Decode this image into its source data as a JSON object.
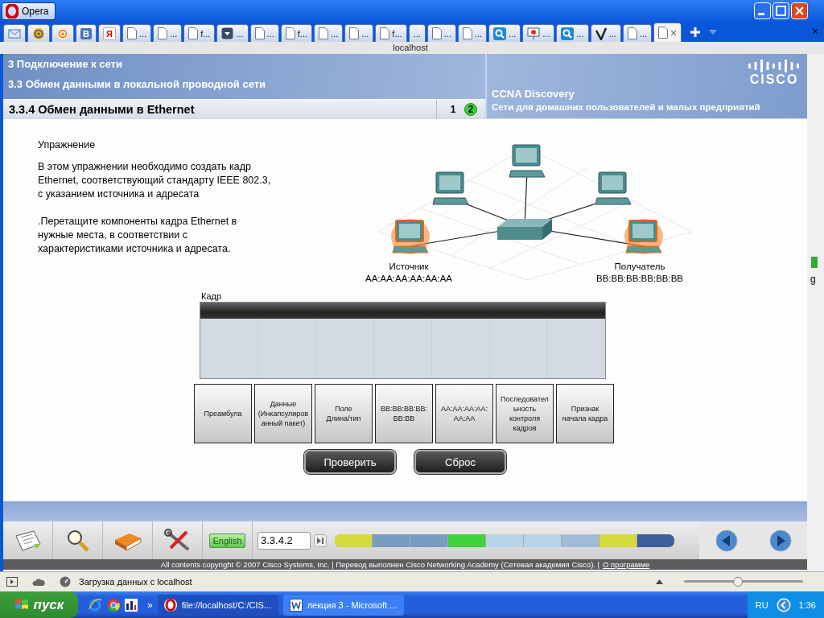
{
  "browser": {
    "menu_button": "Opera",
    "address": "localhost",
    "tabs": [
      {
        "kind": "mail",
        "selected": false
      },
      {
        "kind": "at",
        "selected": false
      },
      {
        "kind": "at-orange",
        "selected": false
      },
      {
        "kind": "letter",
        "glyph": "В",
        "selected": false
      },
      {
        "kind": "letter-red",
        "glyph": "Я",
        "selected": false
      },
      {
        "kind": "page",
        "label": "...",
        "selected": false
      },
      {
        "kind": "page",
        "label": "...",
        "selected": false
      },
      {
        "kind": "page",
        "label": "f...",
        "selected": false
      },
      {
        "kind": "download",
        "label": "...",
        "selected": false
      },
      {
        "kind": "page",
        "label": "...",
        "selected": false
      },
      {
        "kind": "page",
        "label": "f...",
        "selected": false
      },
      {
        "kind": "page",
        "label": "...",
        "selected": false
      },
      {
        "kind": "page",
        "label": "...",
        "selected": false
      },
      {
        "kind": "page",
        "label": "f...",
        "selected": false
      },
      {
        "kind": "blank",
        "label": "...",
        "selected": false
      },
      {
        "kind": "page",
        "label": "...",
        "selected": false
      },
      {
        "kind": "page",
        "label": "...",
        "selected": false
      },
      {
        "kind": "search",
        "label": "...",
        "selected": false
      },
      {
        "kind": "slide",
        "label": "...",
        "selected": false
      },
      {
        "kind": "search",
        "label": "...",
        "selected": false
      },
      {
        "kind": "check",
        "label": "...",
        "selected": false
      },
      {
        "kind": "page",
        "label": "...",
        "selected": false
      },
      {
        "kind": "page",
        "close": "×",
        "selected": true
      }
    ],
    "side_texts": [
      "×",
      "g"
    ]
  },
  "course": {
    "chapter": "3 Подключение к сети",
    "section": "3.3 Обмен данными в локальной проводной сети",
    "topic": "3.3.4 Обмен данными в Ethernet",
    "pages": [
      {
        "label": "1",
        "selected": false
      },
      {
        "label": "2",
        "selected": true
      }
    ],
    "brand": "CISCO",
    "product": "CCNA Discovery",
    "subtitle": "Сети для домашних пользователей и малых предприятий"
  },
  "exercise": {
    "heading": "Упражнение",
    "paragraphs": [
      "В этом упражнении необходимо создать кадр Ethernet, соответствующий стандарту IEEE 802.3, с указанием источника и адресата",
      ".Перетащите компоненты кадра Ethernet в нужные места, в соответствии с характеристиками источника и адресата."
    ],
    "nodes": [
      {
        "kind": "pc",
        "highlighted": false
      },
      {
        "kind": "pc",
        "highlighted": false
      },
      {
        "kind": "pc",
        "highlighted": false
      },
      {
        "kind": "pc",
        "highlighted": true
      },
      {
        "kind": "pc",
        "highlighted": true
      },
      {
        "kind": "switch",
        "highlighted": false
      }
    ],
    "endpoints": [
      {
        "name": "Источник",
        "address": "AA:AA:AA:AA:AA:AA"
      },
      {
        "name": "Получатель",
        "address": "BB:BB:BB:BB:BB:BB"
      }
    ],
    "frame_label": "Кадр",
    "components": [
      "Преамбула",
      "Данные\n(Инкапсулиров\nанный пакет)",
      "Поле\nДлина/тип",
      "BB:BB:BB:BB:\nBB:BB",
      "AA:AA:AA:AA:\nAA:AA",
      "Последовател\nьность\nконтроля\nкадров",
      "Признак\nначала кадра"
    ],
    "buttons": [
      "Проверить",
      "Сброс"
    ]
  },
  "toolbar": {
    "language": "English",
    "page_field": "3.3.4.2",
    "progress": [
      {
        "color": "#d3dc3a"
      },
      {
        "color": "#7b9cc1"
      },
      {
        "color": "#7b9cc1"
      },
      {
        "color": "#3ed43a"
      },
      {
        "color": "#b7d4ea"
      },
      {
        "color": "#b7d4ea"
      },
      {
        "color": "#a0bcd6"
      },
      {
        "color": "#d3dc3a"
      },
      {
        "color": "#3d5f9a"
      }
    ],
    "copyright": "All contents copyright © 2007 Cisco Systems, Inc. | Перевод выполнен Cisco Networking Academy (Сетевая академия Cisco). |",
    "about_link": "О программе"
  },
  "status_bar": {
    "text": "Загрузка данных с localhost",
    "zoom": {
      "level": 0.45
    }
  },
  "taskbar": {
    "start": "пуск",
    "more": "»",
    "tasks": [
      {
        "kind": "opera",
        "label": "file://localhost/C:/CIS...",
        "selected": true
      },
      {
        "kind": "word",
        "label": "лекция 3 - Microsoft ...",
        "selected": false
      }
    ],
    "language": "RU",
    "clock": "1:36"
  }
}
